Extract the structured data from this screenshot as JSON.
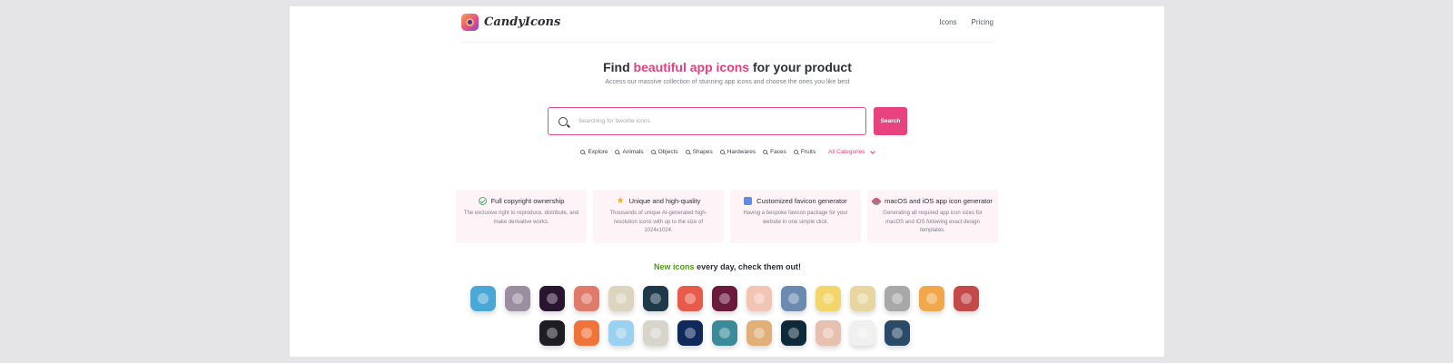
{
  "app": {
    "name": "CandyIcons"
  },
  "nav": {
    "items": [
      "Icons",
      "Pricing"
    ]
  },
  "hero": {
    "title_pre": "Find ",
    "title_accent": "beautiful app icons",
    "title_post": " for your product",
    "subtitle": "Access our massive collection of stunning app icons and choose the ones you like best"
  },
  "search": {
    "placeholder": "Searching for favorite icons",
    "button_label": "Search"
  },
  "categories": [
    "Explore",
    "Animals",
    "Objects",
    "Shapes",
    "Hardwares",
    "Faces",
    "Fruits"
  ],
  "all_categories_label": "All Categories",
  "features": [
    {
      "icon": "check-circle-icon",
      "title": "Full copyright ownership",
      "desc": "The exclusive right to reproduce, distribute, and make derivative works."
    },
    {
      "icon": "star-icon",
      "title": "Unique and high-quality",
      "desc": "Thousands of unique AI-generated high-resolution icons with up to the size of 1024x1024."
    },
    {
      "icon": "thumbs-up-icon",
      "title": "Customized favicon generator",
      "desc": "Having a bespoke favicon package for your website in one simple click."
    },
    {
      "icon": "rocket-icon",
      "title": "macOS and iOS app icon generator",
      "desc": "Generating all required app icon sizes for macOS and iOS following exact design templates."
    }
  ],
  "new_section": {
    "accent": "New icons",
    "rest": " every day, check them out!"
  },
  "icon_colors": {
    "row1": [
      "#4aa8d6",
      "#9a8ea0",
      "#2a1530",
      "#e07a6a",
      "#ddd4c0",
      "#1e3a4a",
      "#e85a4a",
      "#6a1a3a",
      "#f2c4b4",
      "#6a8ab0",
      "#f2d66a",
      "#e8d6a0",
      "#a8a8a8",
      "#f0a84a",
      "#c44a4a"
    ],
    "row2": [
      "#1e1e22",
      "#f0743a",
      "#9ad0f0",
      "#d8d4cc",
      "#0f2a5a",
      "#3a8a9a",
      "#e0b078",
      "#0e2a3a",
      "#e8c0b0",
      "#f0f0f0",
      "#2a4a6a"
    ]
  }
}
